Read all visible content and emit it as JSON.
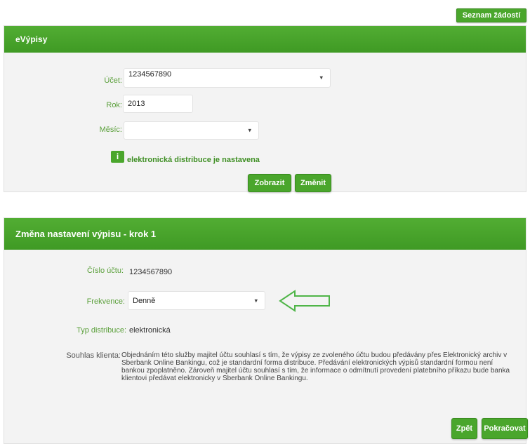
{
  "top_button": {
    "label": "Seznam žádostí"
  },
  "panel1": {
    "title": "eVýpisy",
    "ucet": {
      "label": "Účet:",
      "value": "1234567890"
    },
    "rok": {
      "label": "Rok:",
      "value": "2013"
    },
    "mesic": {
      "label": "Měsíc:",
      "value": ""
    },
    "info_badge": "i",
    "info_text": "elektronická distribuce je nastavena",
    "btn_zobrazit": "Zobrazit",
    "btn_zmenit": "Změnit"
  },
  "panel2": {
    "title": "Změna nastavení výpisu - krok 1",
    "cislo_uctu": {
      "label": "Číslo účtu:",
      "value": "1234567890"
    },
    "frekvence": {
      "label": "Frekvence:",
      "value": "Denně"
    },
    "typ": {
      "label": "Typ distribuce:",
      "value": "elektronická"
    },
    "souhlas": {
      "label": "Souhlas klienta:",
      "text": "Objednáním této služby majitel účtu souhlasí s tím, že výpisy ze zvoleného účtu budou předávány přes Elektronický archiv v Sberbank Online Bankingu, což je standardní forma distribuce. Předávání elektronických výpisů standardní formou není bankou zpoplatněno. Zároveň majitel účtu souhlasí s tím, že informace o odmítnutí provedení platebního příkazu bude banka klientovi předávat elektronicky v Sberbank Online Bankingu."
    },
    "btn_zpet": "Zpět",
    "btn_pokracovat": "Pokračovat"
  },
  "colors": {
    "accent": "#4aa62c",
    "label": "#5a9f3a",
    "panel_bg": "#f3f3f3",
    "arrow": "#4fb548"
  },
  "icons": {
    "select_caret": "caret-down-icon",
    "arrow": "arrow-left-outline-icon"
  }
}
